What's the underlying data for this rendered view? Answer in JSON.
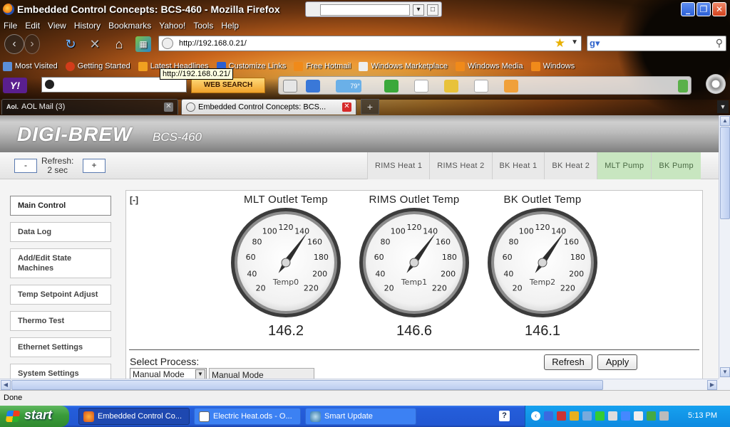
{
  "window": {
    "title": "Embedded Control Concepts: BCS-460 - Mozilla Firefox",
    "min_glyph": "_",
    "max_glyph": "❐",
    "close_glyph": "✕"
  },
  "menu": [
    "File",
    "Edit",
    "View",
    "History",
    "Bookmarks",
    "Yahoo!",
    "Tools",
    "Help"
  ],
  "navigation": {
    "url": "http://192.168.0.21/",
    "search_value": "",
    "tooltip": "http://192.168.0.21/"
  },
  "bookmarks": [
    "Most Visited",
    "Getting Started",
    "Latest Headlines",
    "Customize Links",
    "Free Hotmail",
    "Windows Marketplace",
    "Windows Media",
    "Windows"
  ],
  "yahoo_toolbar": {
    "logo": "Y!",
    "search_value": "",
    "search_button": "WEB SEARCH",
    "weather": "79°"
  },
  "tabs": [
    {
      "label": "AOL Mail (3)",
      "prefix": "Aol."
    },
    {
      "label": "Embedded Control Concepts: BCS..."
    }
  ],
  "new_tab": "+",
  "app": {
    "brand": "DIGI-BREW",
    "model": "BCS-460",
    "refresh_minus": "-",
    "refresh_plus": "+",
    "refresh_label": "Refresh:",
    "refresh_value": "2 sec",
    "outputs": [
      {
        "label": "RIMS Heat 1",
        "on": false
      },
      {
        "label": "RIMS Heat 2",
        "on": false
      },
      {
        "label": "BK Heat 1",
        "on": false
      },
      {
        "label": "BK Heat 2",
        "on": false
      },
      {
        "label": "MLT Pump",
        "on": true
      },
      {
        "label": "BK Pump",
        "on": true
      }
    ],
    "sidebar": [
      "Main Control",
      "Data Log",
      "Add/Edit State Machines",
      "Temp Setpoint Adjust",
      "Thermo Test",
      "Ethernet Settings",
      "System Settings"
    ],
    "collapse_label": "[-]",
    "gauges": [
      {
        "title": "MLT Outlet Temp",
        "sensor": "Temp0",
        "value": "146.2",
        "reading": 146.2
      },
      {
        "title": "RIMS Outlet Temp",
        "sensor": "Temp1",
        "value": "146.6",
        "reading": 146.6
      },
      {
        "title": "BK Outlet Temp",
        "sensor": "Temp2",
        "value": "146.1",
        "reading": 146.1
      }
    ],
    "gauge_scale": {
      "min": 20,
      "max": 220,
      "ticks": [
        20,
        40,
        60,
        80,
        100,
        120,
        140,
        160,
        180,
        200,
        220
      ]
    },
    "select_process_label": "Select Process:",
    "process_select_value": "Manual Mode",
    "process_mode_display": "Manual Mode",
    "refresh_button": "Refresh",
    "apply_button": "Apply"
  },
  "status_text": "Done",
  "taskbar": {
    "start": "start",
    "tasks": [
      "Embedded Control Co...",
      "Electric Heat.ods - O...",
      "Smart Update"
    ],
    "clock": "5:13 PM"
  }
}
